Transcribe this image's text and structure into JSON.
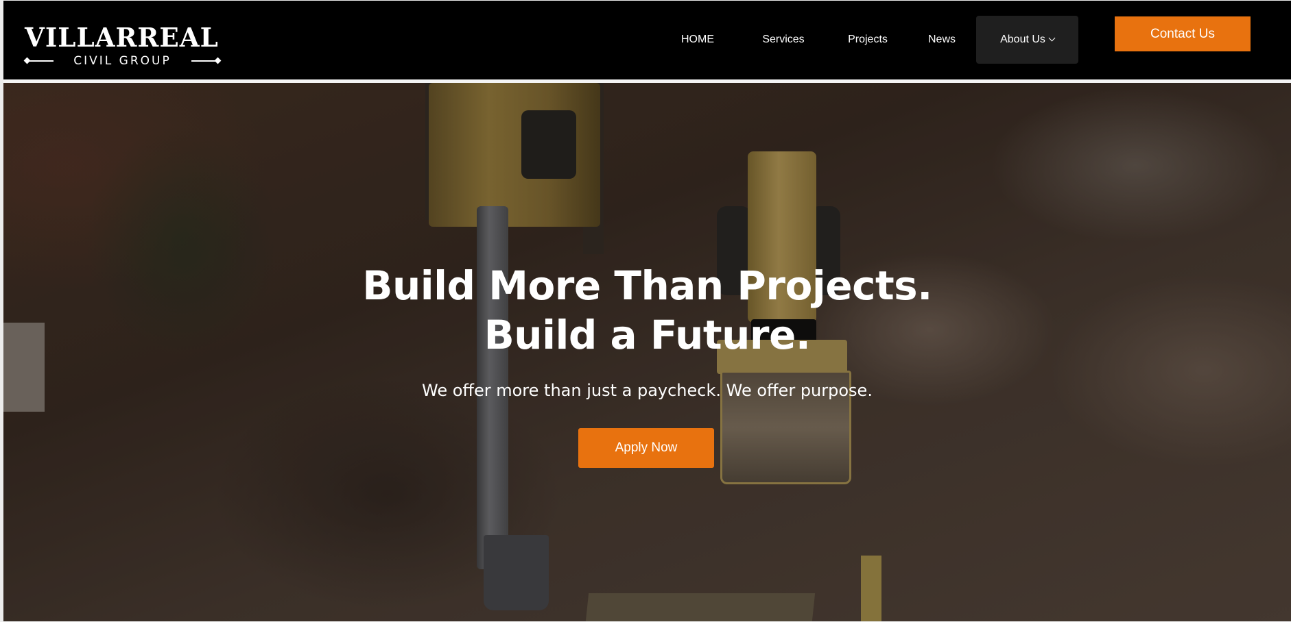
{
  "brand": {
    "name": "VILLARREAL",
    "tagline": "CIVIL GROUP"
  },
  "nav": {
    "items": [
      {
        "label": "HOME"
      },
      {
        "label": "Services"
      },
      {
        "label": "Projects"
      },
      {
        "label": "News"
      },
      {
        "label": "About Us",
        "has_dropdown": true,
        "active": true
      }
    ],
    "contact_label": "Contact Us"
  },
  "hero": {
    "title_line1": "Build More Than Projects.",
    "title_line2": "Build a Future.",
    "subtitle": "We offer more than just a paycheck. We offer purpose.",
    "cta_label": "Apply Now",
    "background_image": "aerial view of construction site with excavator and SAKAI road roller"
  },
  "colors": {
    "accent": "#e8720f",
    "header_bg": "#000000",
    "nav_active_bg": "#1f1f1f",
    "text": "#ffffff"
  }
}
